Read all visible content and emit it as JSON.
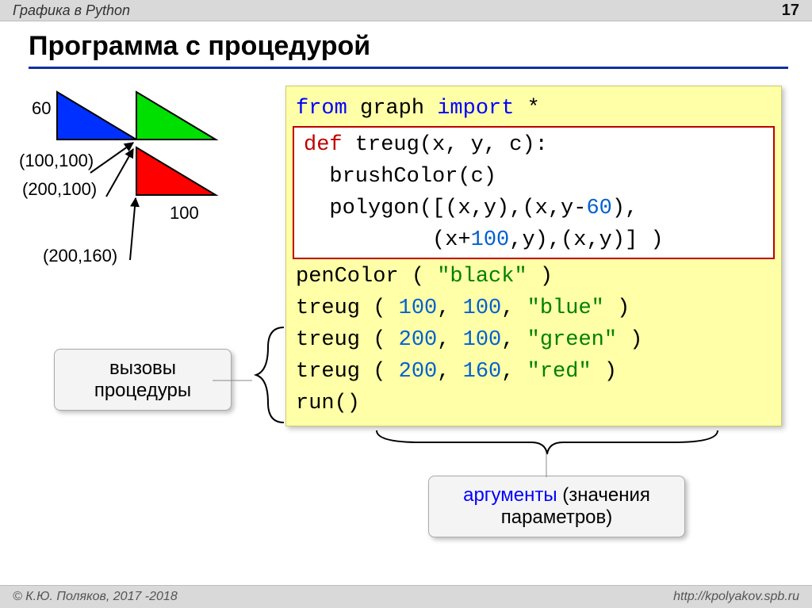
{
  "topbar": {
    "title": "Графика в Python",
    "page": "17"
  },
  "heading": "Программа с процедурой",
  "diagram": {
    "size60": "60",
    "p1": "(100,100)",
    "p2": "(200,100)",
    "p3": "(200,160)",
    "len100": "100"
  },
  "code": {
    "l1a": "from",
    "l1b": " graph ",
    "l1c": "import",
    "l1d": " *",
    "l2a": "def",
    "l2b": " treug(x, y, c):",
    "l3": "  brushColor(c)",
    "l4": "  polygon([(x,y),(x,y-",
    "l4n": "60",
    "l4t": "),",
    "l5": "          (x+",
    "l5n": "100",
    "l5t": ",y),(x,y)] )",
    "l6a": "penColor ( ",
    "l6s": "\"black\"",
    "l6b": " )",
    "l7a": "treug ( ",
    "l7n1": "100",
    "l7c1": ", ",
    "l7n2": "100",
    "l7c2": ", ",
    "l7s": "\"blue\"",
    "l7b": " )",
    "l8a": "treug ( ",
    "l8n1": "200",
    "l8c1": ", ",
    "l8n2": "100",
    "l8c2": ", ",
    "l8s": "\"green\"",
    "l8b": " )",
    "l9a": "treug ( ",
    "l9n1": "200",
    "l9c1": ", ",
    "l9n2": "160",
    "l9c2": ", ",
    "l9s": "\"red\"",
    "l9b": " )",
    "l10": "run()"
  },
  "callouts": {
    "calls_line1": "вызовы",
    "calls_line2": "процедуры",
    "args_a": "аргументы",
    "args_b": " (значения",
    "args_c": "параметров)"
  },
  "footer": {
    "left": "© К.Ю. Поляков, 2017 -2018",
    "right": "http://kpolyakov.spb.ru"
  }
}
